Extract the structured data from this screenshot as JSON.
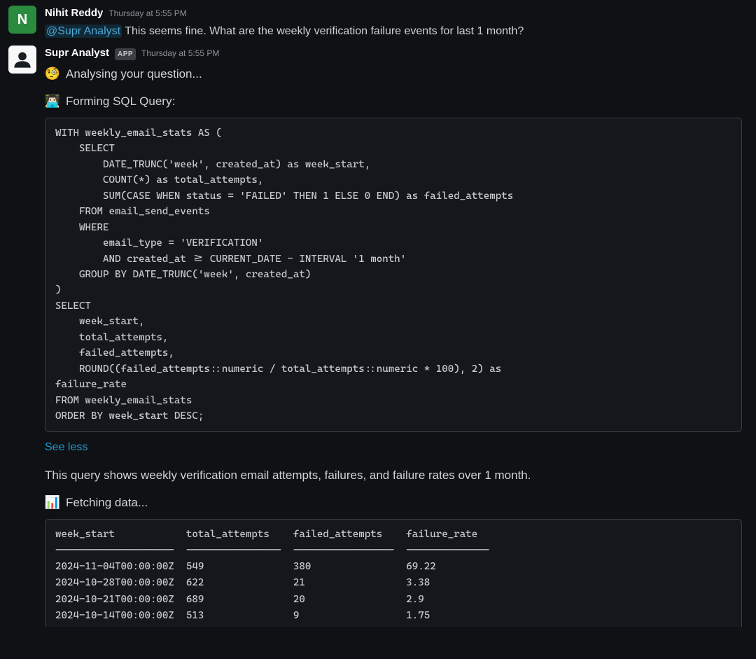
{
  "messages": {
    "user": {
      "avatar_letter": "N",
      "author": "Nihit Reddy",
      "timestamp": "Thursday at 5:55 PM",
      "mention": "@Supr Analyst",
      "text": " This seems fine. What are the weekly verification failure events for last 1 month?"
    },
    "bot": {
      "author": "Supr Analyst",
      "app_badge": "APP",
      "timestamp": "Thursday at 5:55 PM",
      "analysing_text": "Analysing your question...",
      "forming_text": "Forming SQL Query:",
      "sql": "WITH weekly_email_stats AS (\n    SELECT\n        DATE_TRUNC('week', created_at) as week_start,\n        COUNT(*) as total_attempts,\n        SUM(CASE WHEN status = 'FAILED' THEN 1 ELSE 0 END) as failed_attempts\n    FROM email_send_events\n    WHERE\n        email_type = 'VERIFICATION'\n        AND created_at >= CURRENT_DATE - INTERVAL '1 month'\n    GROUP BY DATE_TRUNC('week', created_at)\n)\nSELECT\n    week_start,\n    total_attempts,\n    failed_attempts,\n    ROUND((failed_attempts::numeric / total_attempts::numeric * 100), 2) as\nfailure_rate\nFROM weekly_email_stats\nORDER BY week_start DESC;",
      "see_less": "See less",
      "description": "This query shows weekly verification email attempts, failures, and failure rates over 1 month.",
      "fetching_text": "Fetching data...",
      "result_table": "week_start            total_attempts    failed_attempts    failure_rate\n--------------------  ----------------  -----------------  --------------\n2024-11-04T00:00:00Z  549               380                69.22\n2024-10-28T00:00:00Z  622               21                 3.38\n2024-10-21T00:00:00Z  689               20                 2.9\n2024-10-14T00:00:00Z  513               9                  1.75"
    }
  }
}
